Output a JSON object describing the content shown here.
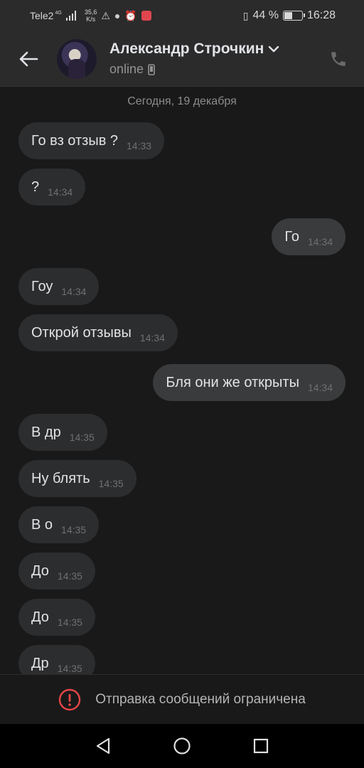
{
  "status_bar": {
    "carrier": "Tele2",
    "network": "4G",
    "speed_value": "35,6",
    "speed_unit": "K/s",
    "icons": [
      "warning-icon",
      "chat-icon",
      "alarm-icon",
      "app-icon"
    ],
    "battery": "44 %",
    "battery_level": 0.44,
    "time": "16:28"
  },
  "header": {
    "back_icon": "arrow-left-icon",
    "name": "Александр Строчкин",
    "status": "online",
    "status_icon": "mobile-icon",
    "call_icon": "phone-icon"
  },
  "chat": {
    "date_separator": "Сегодня, 19 декабря",
    "messages": [
      {
        "dir": "in",
        "text": "Го вз отзыв ?",
        "time": "14:33"
      },
      {
        "dir": "in",
        "text": "?",
        "time": "14:34"
      },
      {
        "dir": "out",
        "text": "Го",
        "time": "14:34"
      },
      {
        "dir": "in",
        "text": "Гоу",
        "time": "14:34"
      },
      {
        "dir": "in",
        "text": "Открой отзывы",
        "time": "14:34"
      },
      {
        "dir": "out",
        "text": "Бля они же открыты",
        "time": "14:34"
      },
      {
        "dir": "in",
        "text": "В др",
        "time": "14:35"
      },
      {
        "dir": "in",
        "text": "Ну блять",
        "time": "14:35"
      },
      {
        "dir": "in",
        "text": "В о",
        "time": "14:35"
      },
      {
        "dir": "in",
        "text": "До",
        "time": "14:35"
      },
      {
        "dir": "in",
        "text": "До",
        "time": "14:35"
      },
      {
        "dir": "in",
        "text": "Др",
        "time": "14:35"
      }
    ]
  },
  "restriction": {
    "icon": "alert-circle-icon",
    "text": "Отправка сообщений ограничена",
    "color": "#e64646"
  },
  "nav": {
    "back_icon": "triangle-back-icon",
    "home_icon": "circle-home-icon",
    "recents_icon": "square-recents-icon"
  }
}
